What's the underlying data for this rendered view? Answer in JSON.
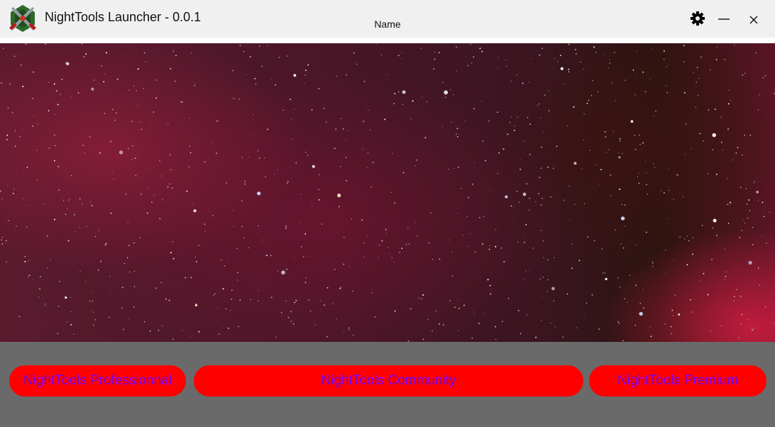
{
  "window": {
    "title": "NightTools Launcher - 0.0.1",
    "name_label": "Name",
    "controls": {
      "settings_icon": "gear-icon",
      "minimize_icon": "minimize-icon",
      "close_icon": "close-icon"
    }
  },
  "banner": {
    "description_icon": "starfield-image"
  },
  "buttons": {
    "professional": "NightTools Professionnal",
    "community": "NightTools Community",
    "premium": "NightTools Premium"
  },
  "colors": {
    "button_bg": "#ff0000",
    "button_text": "#7000ff",
    "panel_bg": "#6a6a6a",
    "titlebar_bg": "#f0f0f0"
  }
}
